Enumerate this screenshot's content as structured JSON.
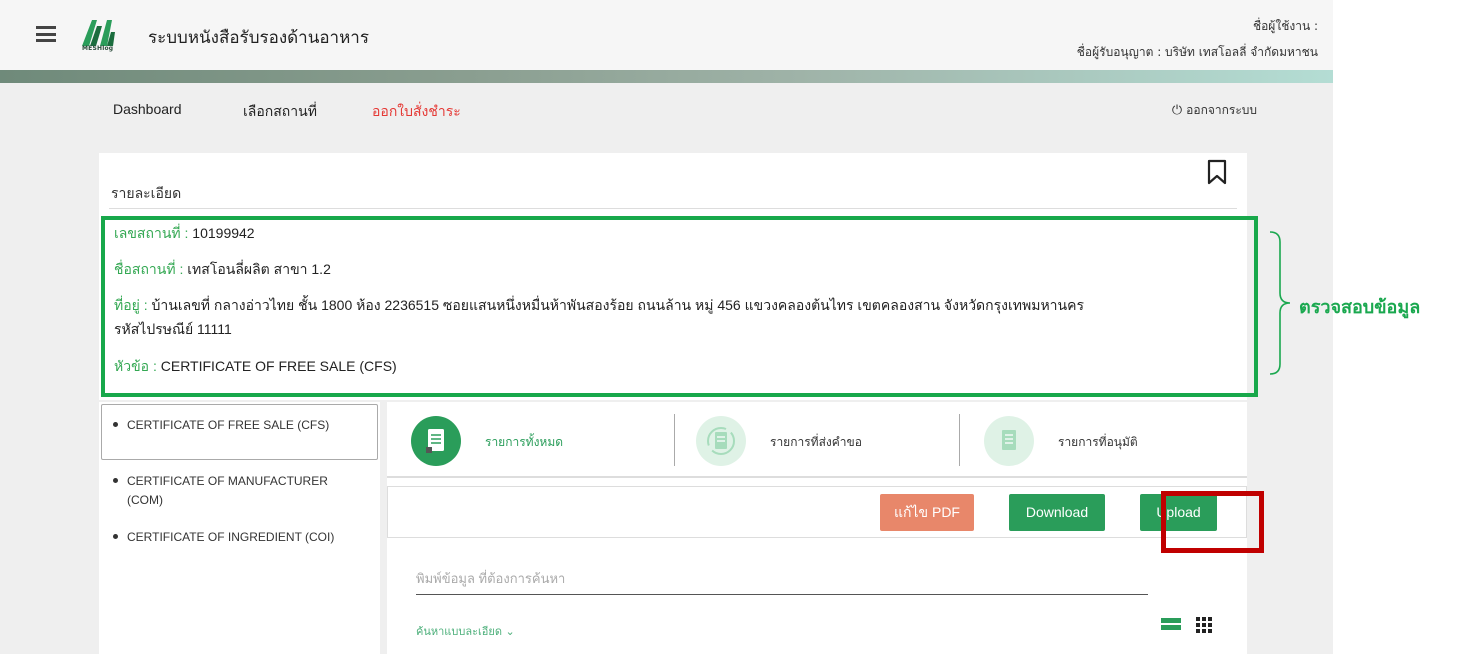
{
  "header": {
    "app_title": "ระบบหนังสือรับรองด้านอาหาร",
    "logo_text": "MESHlog",
    "user_label": "ชื่อผู้ใช้งาน :",
    "licensee_label": "ชื่อผู้รับอนุญาต : บริษัท เทสโอลลี่ จำกัดมหาชน"
  },
  "nav": {
    "items": [
      {
        "label": "Dashboard"
      },
      {
        "label": "เลือกสถานที่"
      },
      {
        "label": "ออกใบสั่งชำระ"
      }
    ],
    "logout_label": "ออกจากระบบ",
    "active_color": "#e53935"
  },
  "detail": {
    "title": "รายละเอียด",
    "place_no_label": "เลขสถานที่ :",
    "place_no": "10199942",
    "place_name_label": "ชื่อสถานที่ :",
    "place_name": "เทสโอนลี่ผลิต สาขา 1.2",
    "address_label": "ที่อยู่ :",
    "address_line1": "บ้านเลขที่ กลางอ่าวไทย ชั้น 1800 ห้อง 2236515 ซอยแสนหนึ่งหมื่นห้าพันสองร้อย ถนนล้าน หมู่ 456 แขวงคลองต้นไทร เขตคลองสาน จังหวัดกรุงเทพมหานคร",
    "address_line2": "รหัสไปรษณีย์ 11111",
    "topic_label": "หัวข้อ :",
    "topic": "CERTIFICATE OF FREE SALE (CFS)"
  },
  "annotation": {
    "label": "ตรวจสอบข้อมูล",
    "color": "#1aa84f"
  },
  "certificates": [
    {
      "label": "CERTIFICATE OF FREE SALE (CFS)"
    },
    {
      "label": "CERTIFICATE OF MANUFACTURER",
      "label2": "(COM)"
    },
    {
      "label": "CERTIFICATE OF INGREDIENT (COI)"
    }
  ],
  "tabs": [
    {
      "label": "รายการทั้งหมด",
      "icon": "document-icon"
    },
    {
      "label": "รายการที่ส่งคำขอ",
      "icon": "sync-document-icon"
    },
    {
      "label": "รายการที่อนุมัติ",
      "icon": "approved-document-icon"
    }
  ],
  "toolbar": {
    "edit_pdf_label": "แก้ไข PDF",
    "download_label": "Download",
    "upload_label": "Upload"
  },
  "search": {
    "placeholder": "พิมพ์ข้อมูล ที่ต้องการค้นหา",
    "advanced_label": "ค้นหาแบบละเอียด ⌄"
  },
  "colors": {
    "primary_green": "#2a9d5a",
    "highlight_box": "#18a84b",
    "upload_highlight": "#c00000",
    "edit_pdf": "#e8876a"
  }
}
